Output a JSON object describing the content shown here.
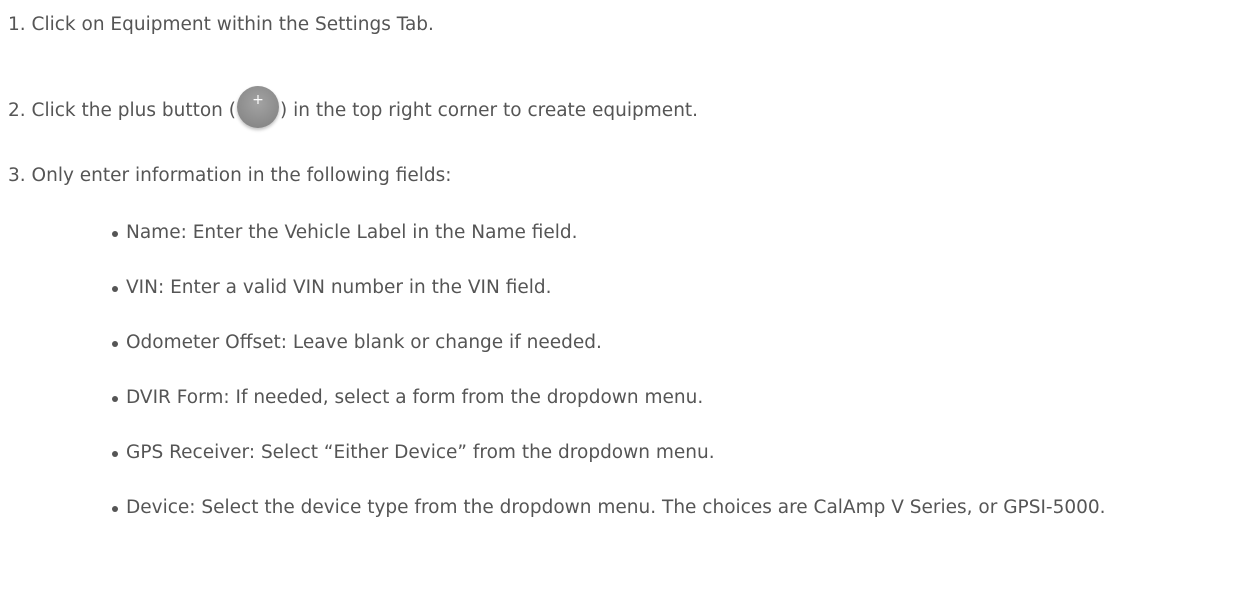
{
  "steps": [
    {
      "number": "1.",
      "text": "Click on Equipment within the Settings Tab."
    },
    {
      "number": "2.",
      "text_before": "Click the plus button (",
      "text_after": ") in the top right corner to create equipment."
    },
    {
      "number": "3.",
      "text": "Only enter information in the following fields:"
    }
  ],
  "plus_icon": {
    "glyph": "+",
    "color": "#8f8f8f"
  },
  "fields": [
    {
      "text": "Name: Enter the Vehicle Label in the Name field."
    },
    {
      "text": "VIN: Enter a valid VIN number in the VIN field."
    },
    {
      "text": "Odometer Offset: Leave blank or change if needed."
    },
    {
      "text": "DVIR Form: If needed, select a form from the dropdown menu."
    },
    {
      "text": "GPS Receiver: Select “Either Device” from the dropdown menu."
    },
    {
      "text": "Device: Select the device type from the dropdown menu. The choices are CalAmp V Series, or GPSI-5000."
    }
  ]
}
